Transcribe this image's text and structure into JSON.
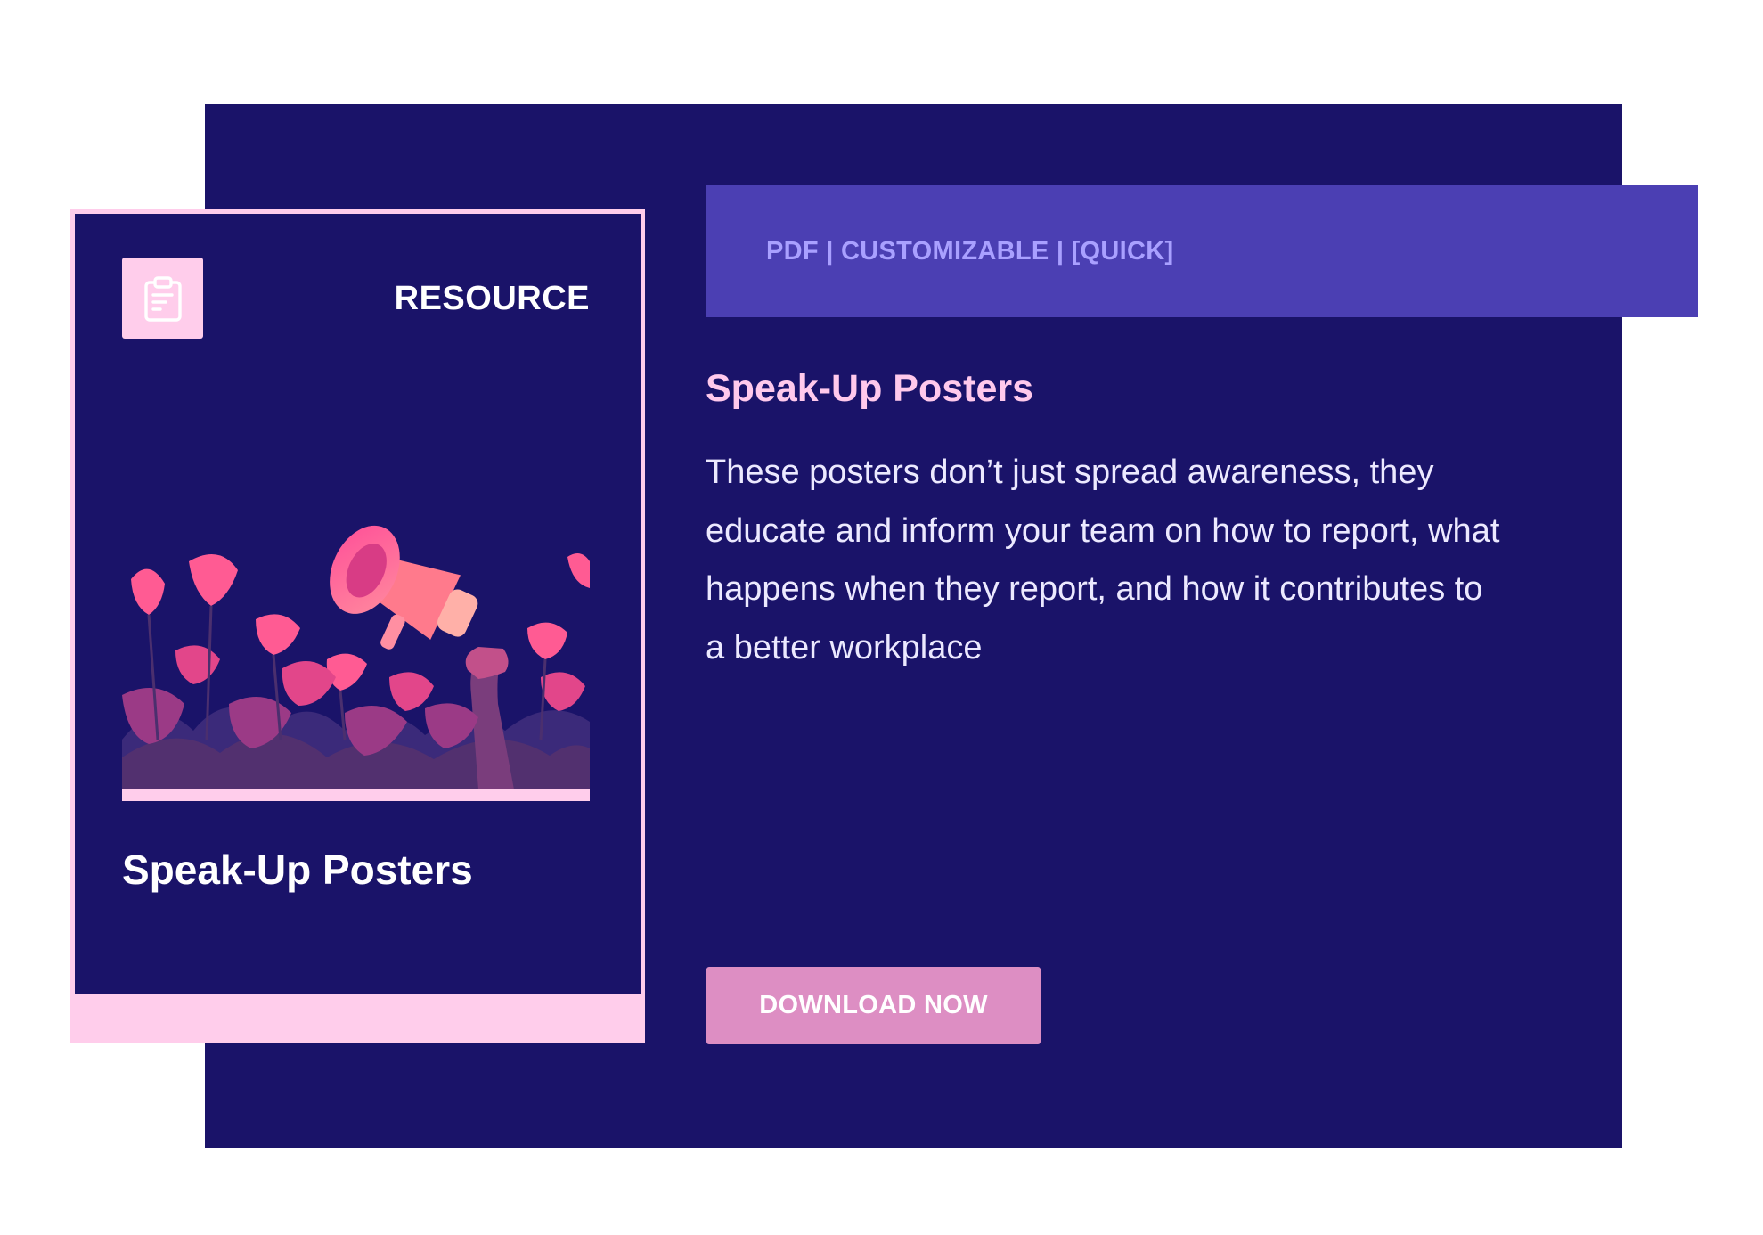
{
  "colors": {
    "panel_bg": "#1a1369",
    "tag_bar_bg": "#4b3fb3",
    "tag_text": "#a9a0ff",
    "accent_pink": "#ffcdeb",
    "heading_pink": "#ffc9ec",
    "button_bg": "#dd8ec3"
  },
  "tags": {
    "text": "PDF | CUSTOMIZABLE | [QUICK]"
  },
  "card": {
    "label": "RESOURCE",
    "title": "Speak-Up Posters",
    "icon": "clipboard-icon",
    "art": "megaphone-flowers-illustration"
  },
  "content": {
    "heading": "Speak-Up Posters",
    "description": "These posters don’t just spread awareness, they educate and inform your team on how to report, what happens when they report, and how it contributes to a better workplace"
  },
  "cta": {
    "download_label": "DOWNLOAD NOW"
  }
}
